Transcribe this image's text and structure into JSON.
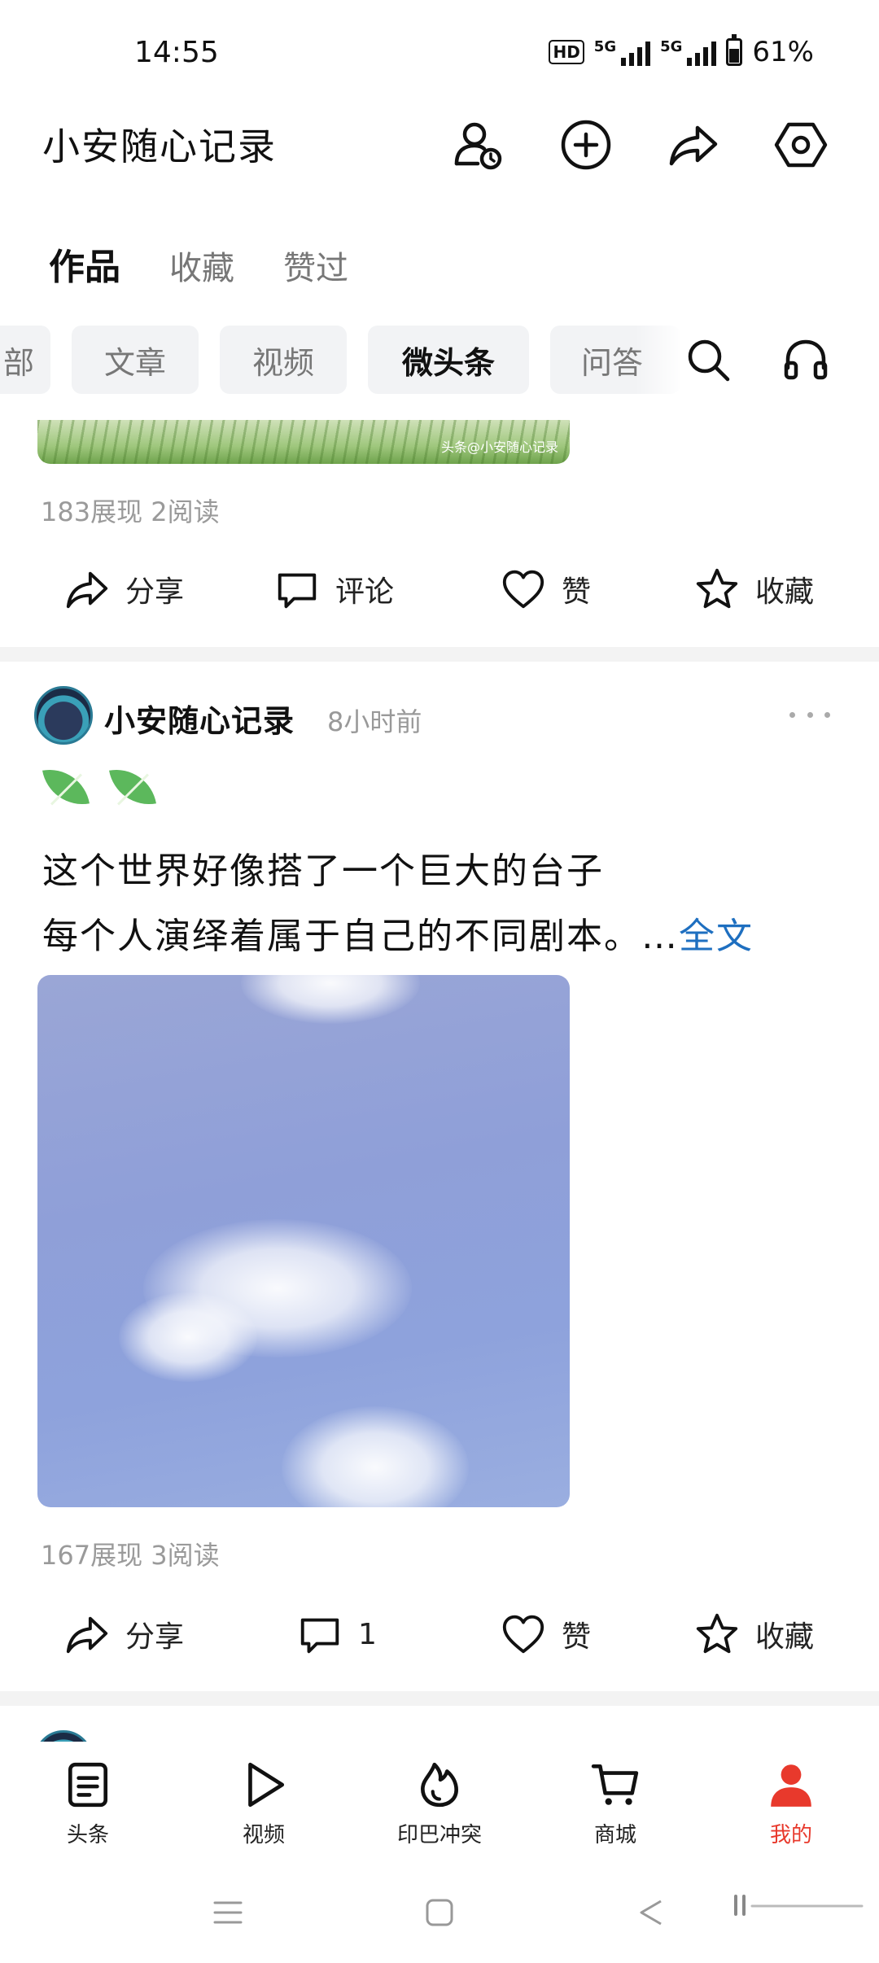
{
  "status_bar": {
    "time": "14:55",
    "hd": "HD",
    "net1": "5G",
    "net2": "5G",
    "battery": "61%"
  },
  "header": {
    "title": "小安随心记录",
    "icons": [
      "user-clock-icon",
      "plus-circle-icon",
      "share-arrow-icon",
      "settings-hexagon-icon"
    ]
  },
  "tabs": [
    {
      "label": "作品",
      "active": true
    },
    {
      "label": "收藏",
      "active": false
    },
    {
      "label": "赞过",
      "active": false
    }
  ],
  "filters": {
    "chips": [
      {
        "label": "部",
        "active": false
      },
      {
        "label": "文章",
        "active": false
      },
      {
        "label": "视频",
        "active": false
      },
      {
        "label": "微头条",
        "active": true
      },
      {
        "label": "问答",
        "active": false
      }
    ],
    "icons": [
      "search-icon",
      "headphones-icon"
    ]
  },
  "post1": {
    "image_watermark": "头条@小安随心记录",
    "stats": "183展现  2阅读",
    "actions": {
      "share": "分享",
      "comment": "评论",
      "like": "赞",
      "favorite": "收藏"
    }
  },
  "post2": {
    "author": "小安随心记录",
    "time": "8小时前",
    "emojis": [
      "leaf",
      "leaf"
    ],
    "line1": "这个世界好像搭了一个巨大的台子",
    "line2": "每个人演绎着属于自己的不同剧本。…",
    "more_link": "全文",
    "stats": "167展现  3阅读",
    "actions": {
      "share": "分享",
      "comment": "1",
      "like": "赞",
      "favorite": "收藏"
    }
  },
  "bottom_nav": [
    {
      "label": "头条",
      "icon": "article-icon",
      "active": false
    },
    {
      "label": "视频",
      "icon": "play-icon",
      "active": false
    },
    {
      "label": "印巴冲突",
      "icon": "flame-icon",
      "active": false
    },
    {
      "label": "商城",
      "icon": "cart-icon",
      "active": false
    },
    {
      "label": "我的",
      "icon": "profile-icon",
      "active": true
    }
  ],
  "colors": {
    "accent_red": "#e8392c",
    "link_blue": "#1e6fc0",
    "muted_gray": "#9a9a9a",
    "chip_bg": "#f2f3f5"
  }
}
